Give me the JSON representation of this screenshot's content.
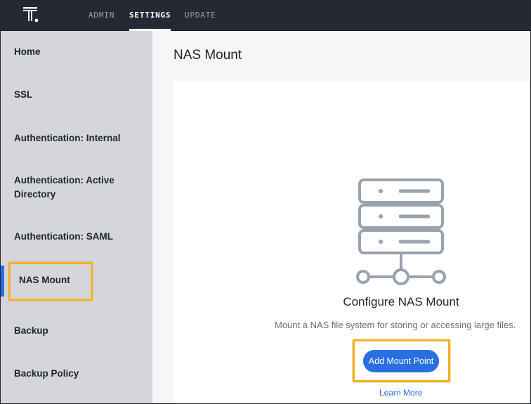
{
  "topnav": {
    "tabs": [
      {
        "label": "ADMIN",
        "active": false
      },
      {
        "label": "SETTINGS",
        "active": true
      },
      {
        "label": "UPDATE",
        "active": false
      }
    ]
  },
  "sidebar": {
    "items": [
      {
        "label": "Home"
      },
      {
        "label": "SSL"
      },
      {
        "label": "Authentication: Internal"
      },
      {
        "label": "Authentication: Active Directory"
      },
      {
        "label": "Authentication: SAML"
      },
      {
        "label": "NAS Mount",
        "active": true
      },
      {
        "label": "Backup"
      },
      {
        "label": "Backup Policy"
      }
    ]
  },
  "main": {
    "title": "NAS Mount",
    "empty_state": {
      "icon": "server-network-icon",
      "title": "Configure NAS Mount",
      "description": "Mount a NAS file system for storing or accessing large files.",
      "button_label": "Add Mount Point",
      "link_label": "Learn More"
    }
  },
  "colors": {
    "topbar": "#232a33",
    "sidebar": "#d4d6db",
    "accent": "#2a6fe0",
    "highlight": "#f3b321",
    "icon_stroke": "#9aa2ad"
  }
}
